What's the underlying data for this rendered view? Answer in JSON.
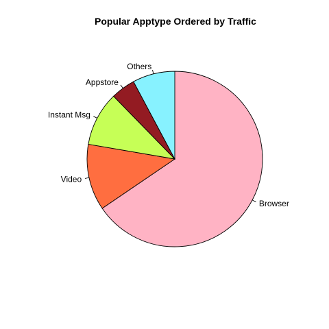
{
  "chart_data": {
    "type": "pie",
    "title": "Popular Apptype Ordered by Traffic",
    "slices": [
      {
        "label": "Browser",
        "value": 0.655,
        "color": "#FFB3C4"
      },
      {
        "label": "Video",
        "value": 0.122,
        "color": "#FF6E40"
      },
      {
        "label": "Instant Msg",
        "value": 0.1,
        "color": "#C6FF56"
      },
      {
        "label": "Appstore",
        "value": 0.045,
        "color": "#931B22"
      },
      {
        "label": "Others",
        "value": 0.078,
        "color": "#87F2FF"
      }
    ],
    "start": "top",
    "direction": "clockwise"
  }
}
